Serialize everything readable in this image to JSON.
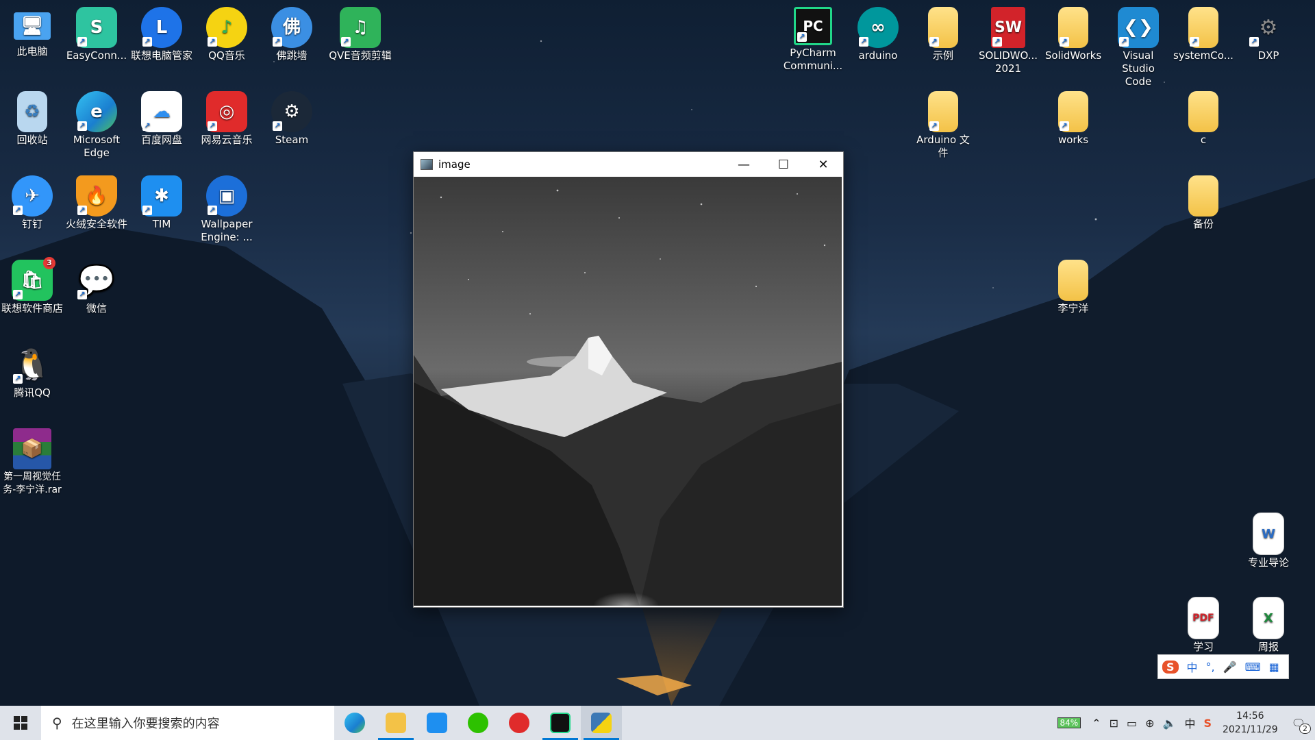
{
  "desktop": {
    "left_icons": [
      {
        "label": "此电脑",
        "icon": "computer-icon",
        "color": "#4aa3f0"
      },
      {
        "label": "EasyConn...",
        "icon": "easyconnect-icon",
        "color": "#2ec4a0"
      },
      {
        "label": "联想电脑管家",
        "icon": "lenovo-manager-icon",
        "color": "#1e73e8"
      },
      {
        "label": "QQ音乐",
        "icon": "qq-music-icon",
        "color": "#f5d312"
      },
      {
        "label": "佛跳墙",
        "icon": "fotiaoqiang-icon",
        "color": "#3b8fe3"
      },
      {
        "label": "QVE音频剪辑",
        "icon": "qve-audio-icon",
        "color": "#2fb35a"
      },
      {
        "label": "回收站",
        "icon": "recycle-bin-icon",
        "color": "#b9d7ef"
      },
      {
        "label": "Microsoft Edge",
        "icon": "edge-icon",
        "color": "#1a9de0"
      },
      {
        "label": "百度网盘",
        "icon": "baidu-netdisk-icon",
        "color": "#ffffff"
      },
      {
        "label": "网易云音乐",
        "icon": "netease-music-icon",
        "color": "#e02b2b"
      },
      {
        "label": "Steam",
        "icon": "steam-icon",
        "color": "#1b2838"
      },
      {
        "label": "钉钉",
        "icon": "dingtalk-icon",
        "color": "#3296fa"
      },
      {
        "label": "火绒安全软件",
        "icon": "huorong-icon",
        "color": "#f39a1e"
      },
      {
        "label": "TIM",
        "icon": "tim-icon",
        "color": "#1e8ff0"
      },
      {
        "label": "Wallpaper Engine: ...",
        "icon": "wallpaper-engine-icon",
        "color": "#1c6fd9"
      },
      {
        "label": "联想软件商店",
        "icon": "lenovo-store-icon",
        "color": "#22c35e",
        "badge": "3"
      },
      {
        "label": "微信",
        "icon": "wechat-icon",
        "color": "#2dc100"
      },
      {
        "label": "腾讯QQ",
        "icon": "qq-icon",
        "color": "#111111"
      },
      {
        "label": "第一周视觉任务-李宁洋.rar",
        "icon": "winrar-icon",
        "color": "#8e2b8c"
      }
    ],
    "right_icons": [
      {
        "label": "PyCharm Communi...",
        "icon": "pycharm-icon",
        "color": "#111111"
      },
      {
        "label": "arduino",
        "icon": "arduino-icon",
        "color": "#00979c"
      },
      {
        "label": "示例",
        "icon": "folder-icon",
        "color": "#f3c247"
      },
      {
        "label": "SOLIDWO... 2021",
        "icon": "solidworks2021-icon",
        "color": "#d2232a"
      },
      {
        "label": "SolidWorks",
        "icon": "folder-icon",
        "color": "#f3c247"
      },
      {
        "label": "Visual Studio Code",
        "icon": "vscode-icon",
        "color": "#1f8ad2"
      },
      {
        "label": "systemCo...",
        "icon": "folder-icon",
        "color": "#f3c247"
      },
      {
        "label": "DXP",
        "icon": "dxp-icon",
        "color": "#8b8b8b"
      },
      {
        "label": "Arduino 文件",
        "icon": "folder-icon",
        "color": "#f3c247"
      },
      {
        "label": "works",
        "icon": "folder-icon",
        "color": "#f3c247"
      },
      {
        "label": "c",
        "icon": "folder-icon",
        "color": "#f3c247"
      },
      {
        "label": "备份",
        "icon": "folder-icon",
        "color": "#f3c247"
      },
      {
        "label": "李宁洋",
        "icon": "folder-icon",
        "color": "#f3c247"
      },
      {
        "label": "专业导论",
        "icon": "document-icon",
        "color": "#ffffff"
      },
      {
        "label": "学习",
        "icon": "document-icon",
        "color": "#ffffff"
      },
      {
        "label": "周报",
        "icon": "document-icon",
        "color": "#ffffff"
      }
    ]
  },
  "window": {
    "title": "image",
    "minimize": "—",
    "maximize": "☐",
    "close": "✕"
  },
  "ime_bar": {
    "items": [
      "S",
      "中",
      "°,",
      "🎤",
      "⌨",
      "▦"
    ]
  },
  "taskbar": {
    "search_placeholder": "在这里输入你要搜索的内容",
    "apps": [
      {
        "name": "edge",
        "color": "#1a9de0"
      },
      {
        "name": "file-explorer",
        "color": "#f3c247"
      },
      {
        "name": "tim",
        "color": "#1e8ff0"
      },
      {
        "name": "wechat",
        "color": "#2dc100"
      },
      {
        "name": "netease-music",
        "color": "#e02b2b"
      },
      {
        "name": "pycharm",
        "color": "#111111"
      },
      {
        "name": "python-image",
        "color": "#3c78b5"
      }
    ],
    "battery": "84%",
    "tray_lang": "中",
    "time": "14:56",
    "date": "2021/11/29",
    "notification_count": "2"
  }
}
